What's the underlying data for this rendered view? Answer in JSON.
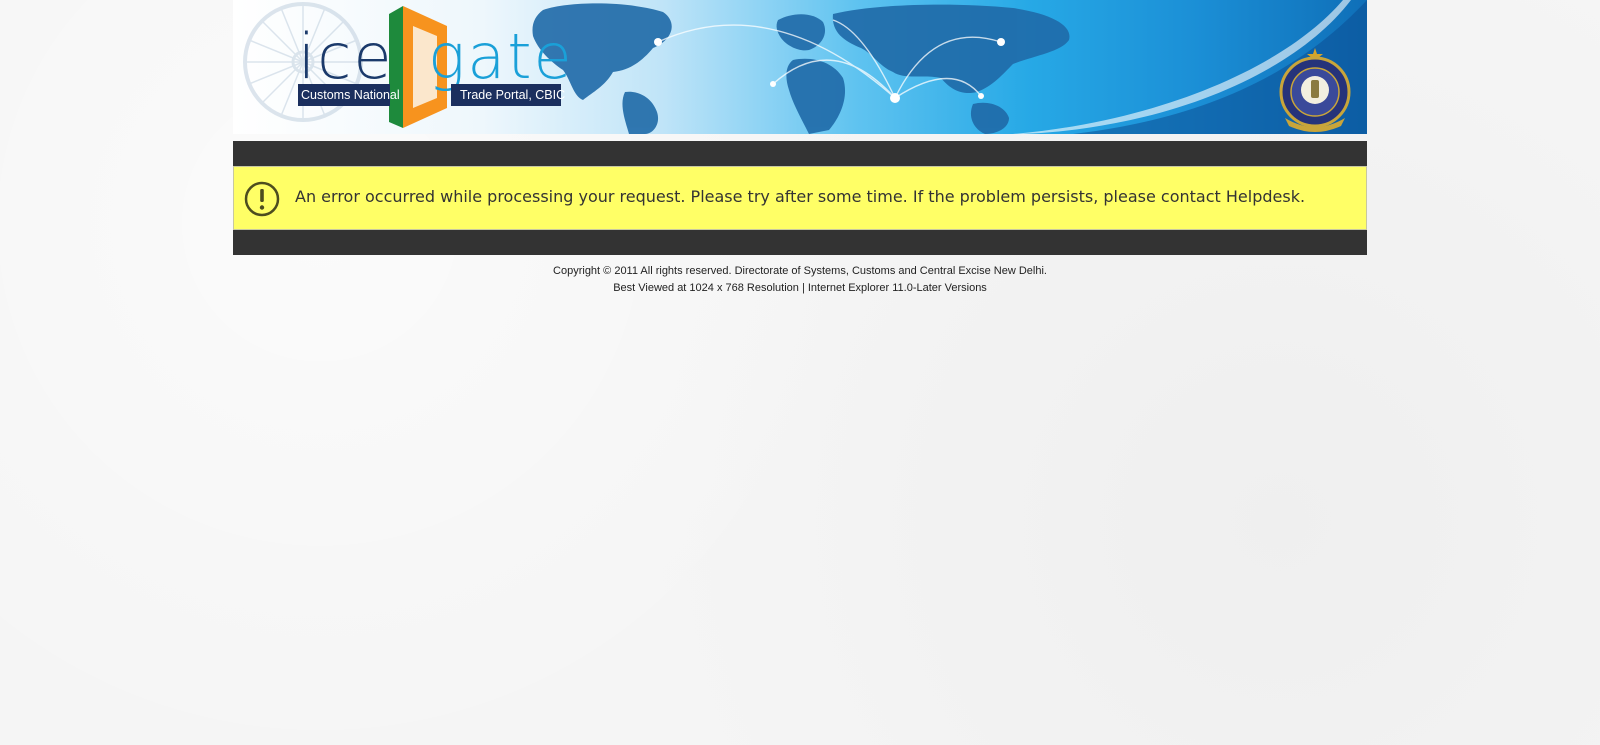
{
  "header": {
    "logo": {
      "word_left": "ice",
      "word_right": "gate",
      "tag_left": "Customs National",
      "tag_right": "Trade Portal, CBIC"
    },
    "emblem_icon": "cbic-emblem-icon",
    "background": "world-map-banner"
  },
  "error": {
    "icon": "exclamation-circle-icon",
    "message": "An error occurred while processing your request. Please try after some time. If the problem persists, please contact Helpdesk."
  },
  "footer": {
    "copyright": "Copyright © 2011 All rights reserved. Directorate of Systems, Customs and Central Excise New Delhi.",
    "best_viewed": "Best Viewed at 1024 x 768 Resolution | Internet Explorer 11.0-Later Versions"
  },
  "colors": {
    "error_background": "#ffff66",
    "bar": "#333333",
    "logo_dark": "#1b2f5e",
    "logo_blue": "#1aa0d8",
    "logo_orange": "#f7931e",
    "logo_green": "#1e8a3c"
  }
}
